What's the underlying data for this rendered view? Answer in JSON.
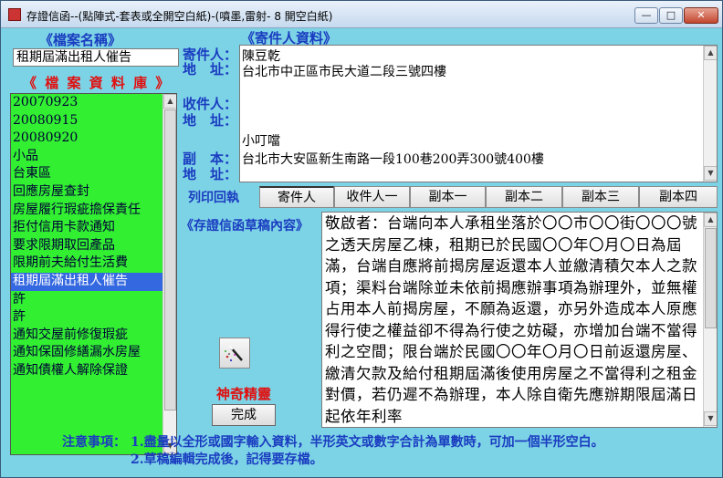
{
  "window": {
    "title": "存證信函--(點陣式-套表或全開空白紙)-(噴墨,雷射- 8 開空白紙)",
    "minimize": "—",
    "maximize": "□",
    "close": "✕"
  },
  "file_section": {
    "label": "《檔案名稱》",
    "filename": "租期屆滿出租人催告"
  },
  "library": {
    "label": "《 檔 案 資 料 庫 》",
    "items": [
      "20070923",
      "20080915",
      "20080920",
      "小品",
      "台東區",
      "回應房屋查封",
      "房屋履行瑕疵擔保責任",
      "拒付信用卡款通知",
      "要求限期取回產品",
      "限期前夫給付生活費",
      "租期屆滿出租人催告",
      "許",
      "許",
      "通知交屋前修復瑕疵",
      "通知保固修繕漏水房屋",
      "通知債權人解除保證"
    ],
    "selected_index": 10
  },
  "party": {
    "section_label": "《寄件人資料》",
    "sender_label": "寄件人：",
    "sender_addr_label": "地　址：",
    "recipient_label": "收件人：",
    "recipient_addr_label": "地　址：",
    "cc_label": "副　本：",
    "cc_addr_label": "地　址：",
    "sender_name": "陳豆乾",
    "sender_address": "台北市中正區市民大道二段三號四樓",
    "recipient_name": "小叮噹",
    "recipient_address": "台北市大安區新生南路一段100巷200弄300號400樓"
  },
  "print_tabs": {
    "label": "列印回執",
    "tabs": [
      "寄件人",
      "收件人一",
      "副本一",
      "副本二",
      "副本三",
      "副本四"
    ]
  },
  "draft": {
    "label": "《存證信函草稿內容》",
    "text": "敬啟者：台端向本人承租坐落於〇〇市〇〇街〇〇〇號之透天房屋乙棟，租期已於民國〇〇年〇月〇日為屆滿，台端自應將前揭房屋返還本人並繳清積欠本人之款項；渠料台端除並未依前揭應辦事項為辦理外，並無權占用本人前揭房屋，不願為返還，亦另外造成本人原應得行使之權益卻不得為行使之妨礙，亦增加台端不當得利之空間；限台端於民國〇〇年〇月〇日前返還房屋、繳清欠款及給付租期屆滿後使用房屋之不當得利之租金對價，若仍遲不為辦理，本人除自衛先應辦期限屆滿日起依年利率"
  },
  "actions": {
    "magic_label": "神奇精靈",
    "done_label": "完成"
  },
  "notice": {
    "title": "注意事項：",
    "line1": "1.盡量以全形或國字輸入資料，半形英文或數字合計為單數時，可加一個半形空白。",
    "line2": "2.草稿編輯完成後，記得要存檔。"
  },
  "colors": {
    "background": "#7dd3e6",
    "list_bg": "#32ef32",
    "selected": "#3468e0",
    "label_blue": "#1a3cc0",
    "label_red": "#e01010"
  },
  "icons": {
    "app": "app-icon",
    "magic": "magic-wand-icon"
  }
}
